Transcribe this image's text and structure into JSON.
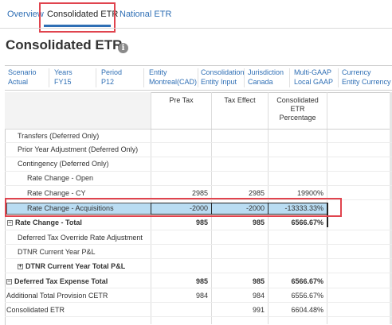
{
  "tabs": [
    {
      "label": "Overview",
      "active": false
    },
    {
      "label": "Consolidated ETR",
      "active": true
    },
    {
      "label": "National ETR",
      "active": false
    }
  ],
  "page": {
    "title": "Consolidated ETR",
    "info_icon": "info-icon"
  },
  "pov": [
    {
      "label": "Scenario",
      "value": "Actual"
    },
    {
      "label": "Years",
      "value": "FY15"
    },
    {
      "label": "Period",
      "value": "P12"
    },
    {
      "label": "Entity",
      "value": "Montreal(CAD)"
    },
    {
      "label": "Consolidation",
      "value": "Entity Input"
    },
    {
      "label": "Jurisdiction",
      "value": "Canada"
    },
    {
      "label": "Multi-GAAP",
      "value": "Local GAAP"
    },
    {
      "label": "Currency",
      "value": "Entity Currency"
    }
  ],
  "grid": {
    "columns": [
      {
        "label": "Pre Tax"
      },
      {
        "label": "Tax Effect"
      },
      {
        "label": "Consolidated\nETR\nPercentage"
      }
    ],
    "rows": [
      {
        "label": "Transfers (Deferred Only)",
        "pre_tax": "",
        "tax_effect": "",
        "etr": ""
      },
      {
        "label": "Prior Year Adjustment (Deferred Only)",
        "pre_tax": "",
        "tax_effect": "",
        "etr": ""
      },
      {
        "label": "Contingency (Deferred Only)",
        "pre_tax": "",
        "tax_effect": "",
        "etr": ""
      },
      {
        "label": "Rate Change - Open",
        "pre_tax": "",
        "tax_effect": "",
        "etr": ""
      },
      {
        "label": "Rate Change - CY",
        "pre_tax": "2985",
        "tax_effect": "2985",
        "etr": "19900%"
      },
      {
        "label": "Rate Change - Acquisitions",
        "pre_tax": "-2000",
        "tax_effect": "-2000",
        "etr": "-13333.33%"
      },
      {
        "label": "Rate Change - Total",
        "pre_tax": "985",
        "tax_effect": "985",
        "etr": "6566.67%"
      },
      {
        "label": "Deferred Tax Override Rate Adjustment",
        "pre_tax": "",
        "tax_effect": "",
        "etr": ""
      },
      {
        "label": "DTNR Current Year P&L",
        "pre_tax": "",
        "tax_effect": "",
        "etr": ""
      },
      {
        "label": "DTNR Current Year Total P&L",
        "pre_tax": "",
        "tax_effect": "",
        "etr": ""
      },
      {
        "label": "Deferred Tax Expense Total",
        "pre_tax": "985",
        "tax_effect": "985",
        "etr": "6566.67%"
      },
      {
        "label": "Additional Total Provision CETR",
        "pre_tax": "984",
        "tax_effect": "984",
        "etr": "6556.67%"
      },
      {
        "label": "Consolidated ETR",
        "pre_tax": "",
        "tax_effect": "991",
        "etr": "6604.48%"
      }
    ],
    "toggles": {
      "collapse": "−",
      "expand": "+"
    }
  },
  "colors": {
    "link": "#2f6fb5",
    "highlight": "#e0444e",
    "selection": "#b9dcf2"
  }
}
